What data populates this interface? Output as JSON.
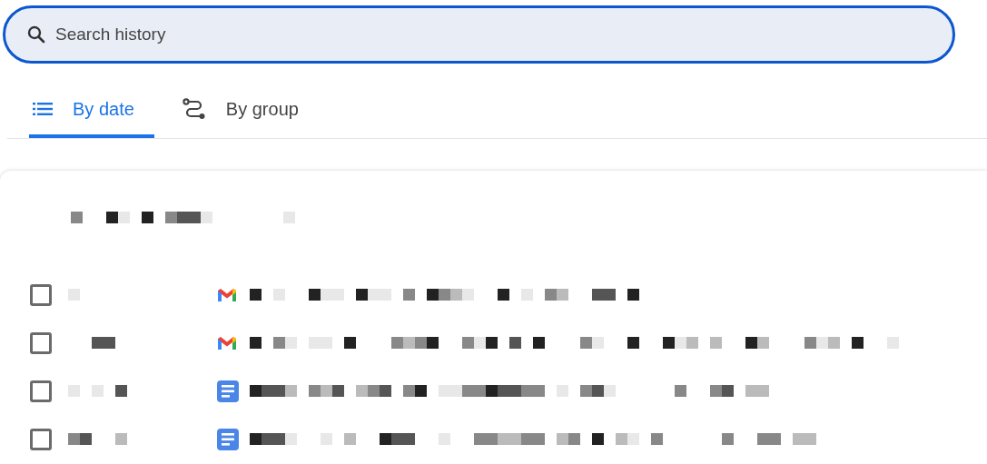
{
  "search": {
    "placeholder": "Search history"
  },
  "tabs": [
    {
      "label": "By date",
      "kind": "list",
      "selected": true
    },
    {
      "label": "By group",
      "kind": "group",
      "selected": false
    }
  ],
  "rows": [
    {
      "checked": false,
      "kind": "mail"
    },
    {
      "checked": false,
      "kind": "mail"
    },
    {
      "checked": false,
      "kind": "doc"
    },
    {
      "checked": false,
      "kind": "doc"
    }
  ]
}
